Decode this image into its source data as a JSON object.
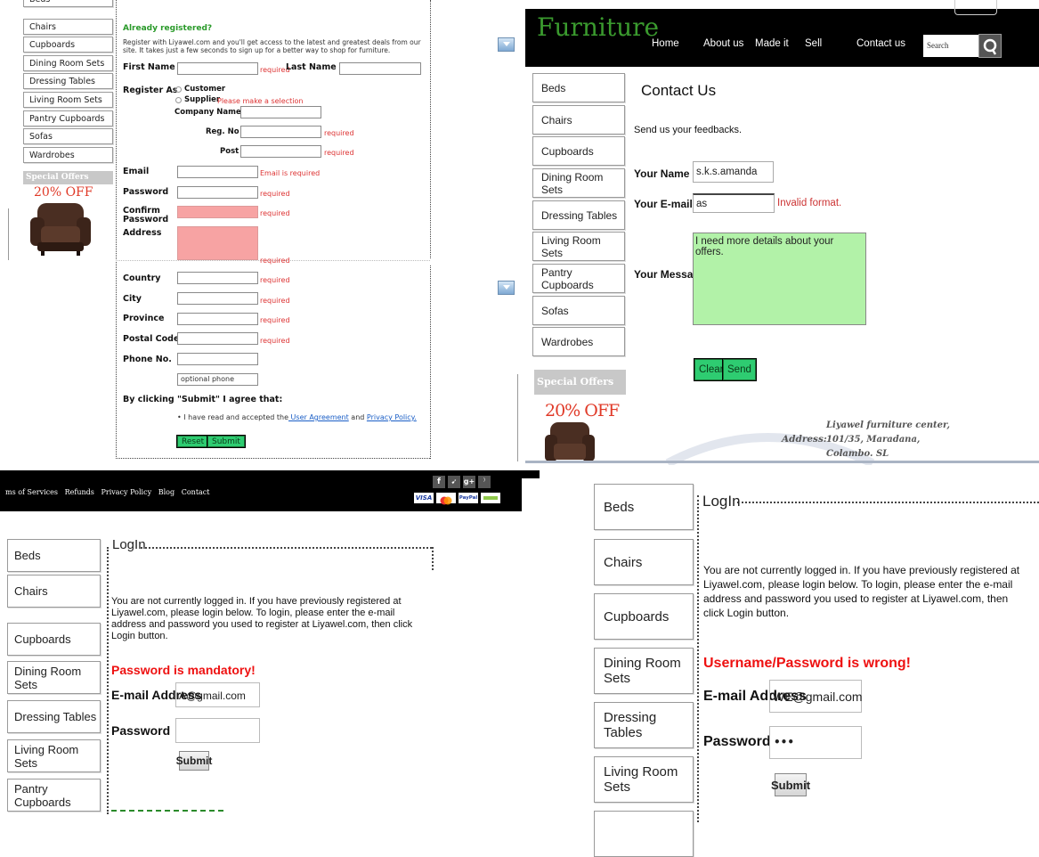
{
  "categories": [
    "Beds",
    "Chairs",
    "Cupboards",
    "Dining Room Sets",
    "Dressing Tables",
    "Living Room Sets",
    "Pantry Cupboards",
    "Sofas",
    "Wardrobes"
  ],
  "special_offers": "Special Offers",
  "offer_badge": "20% OFF",
  "register": {
    "already_registered": "Already registered?",
    "intro": "Register with Liyawel.com and you'll get access to the latest and greatest deals from our site. It takes just a few seconds to sign up for a better way to shop for furniture.",
    "first_name": "First Name",
    "last_name": "Last Name",
    "required": "required",
    "register_as": "Register As",
    "customer": "Customer",
    "supplier": "Supplier",
    "make_selection": "Please make a selection",
    "company_name": "Company Name",
    "reg_no": "Reg. No",
    "post": "Post",
    "email": "Email",
    "email_required": "Email is required",
    "password": "Password",
    "confirm_password": "Confirm Password",
    "address": "Address",
    "country": "Country",
    "city": "City",
    "province": "Province",
    "postal_code": "Postal Code",
    "phone": "Phone No.",
    "optional_phone": "optional phone",
    "agree_heading": "By clicking \"Submit\" I agree that:",
    "agree_prefix": "• I have read and accepted the",
    "user_agreement": " User Agreement",
    "and": " and ",
    "privacy_policy": "Privacy Policy.",
    "reset": "Reset",
    "submit": "Submit"
  },
  "site": {
    "brand": "Furniture",
    "nav": [
      "Home",
      "About us",
      "Made it",
      "Sell",
      "Contact us"
    ],
    "search_placeholder": "Search"
  },
  "contact": {
    "title": "Contact Us",
    "subtitle": "Send us your feedbacks.",
    "name_label": "Your Name",
    "name_value": "s.k.s.amanda",
    "email_label": "Your E-mail",
    "email_value": "as",
    "email_error": "Invalid format.",
    "message_label": "Your Message",
    "message_value": "I need more details about your offers.",
    "clear": "Clear",
    "send": "Send",
    "address_label": "Address:",
    "address_lines": [
      "Liyawel furniture center,",
      "101/35, Maradana,",
      "Colambo. SL"
    ]
  },
  "footer": {
    "links": "ms of Services   Refunds   Privacy Policy   Blog   Contact",
    "social": [
      "f",
      "t",
      "g+",
      "rss"
    ],
    "payments": [
      "VISA",
      "MC",
      "PayPal",
      "other"
    ]
  },
  "login1": {
    "title": "LogIn",
    "intro": "You are not currently logged in. If you have previously registered at Liyawel.com, please login below. To login, please enter the e-mail address and password you used to register at Liyawel.com, then click Login button.",
    "error": "Password is mandatory!",
    "email_label": "E-mail Address",
    "email_value": "A@gmail.com",
    "password_label": "Password",
    "submit": "Submit"
  },
  "login2": {
    "title": "LogIn",
    "intro": "You are not currently logged in. If you have previously registered at Liyawel.com, please login below. To login, please enter the e-mail address and password you used to register at Liyawel.com, then click Login button.",
    "error": "Username/Password is wrong!",
    "email_label": "E-mail Address",
    "email_value": "WE@gmail.com",
    "password_label": "Password",
    "password_mask": "•••",
    "submit": "Submit"
  }
}
